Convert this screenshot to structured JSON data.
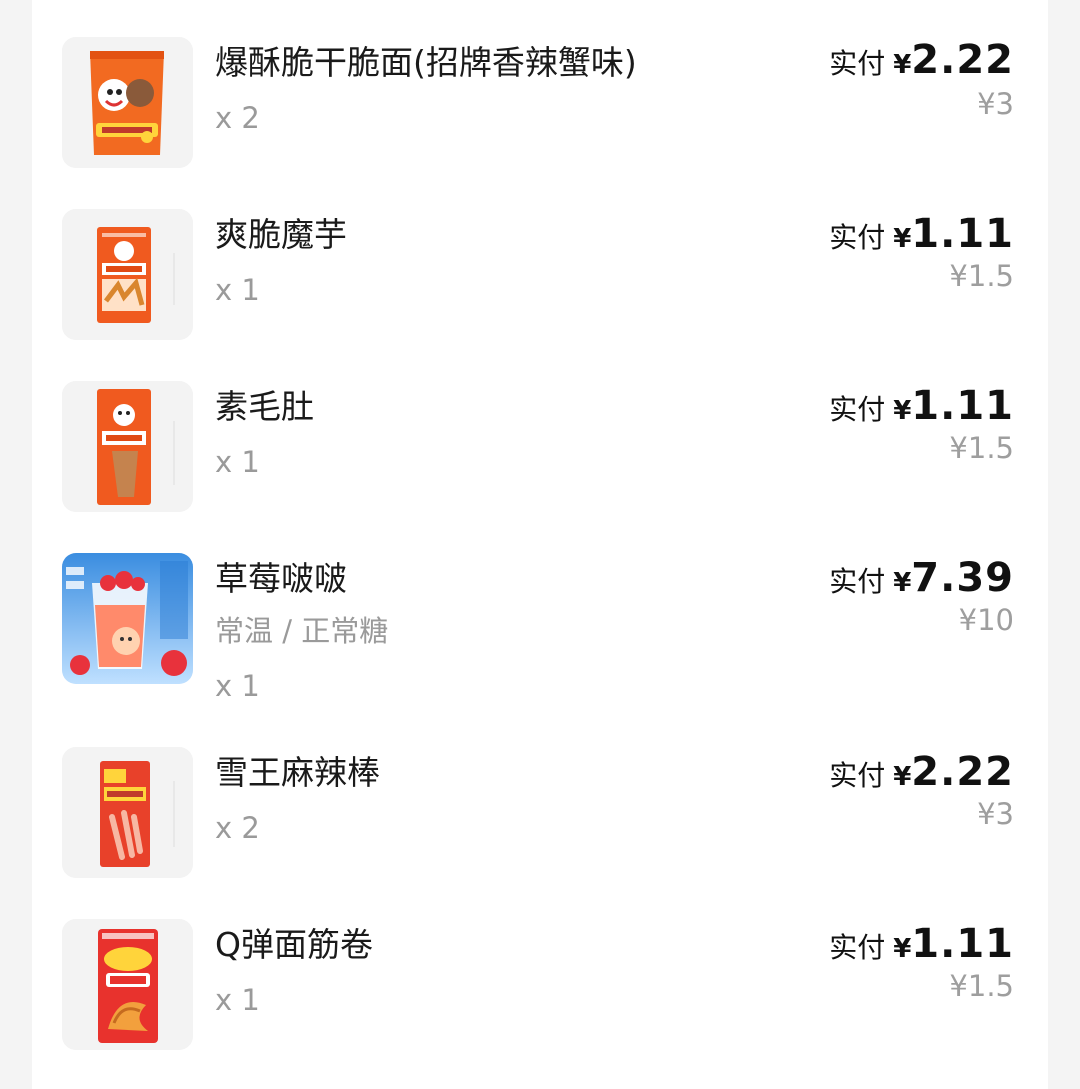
{
  "order": {
    "paid_label": "实付",
    "currency": "¥",
    "items": [
      {
        "name": "爆酥脆干脆面(招牌香辣蟹味)",
        "spec": "",
        "qty": "x 2",
        "paid": "2.22",
        "original": "¥3",
        "image": "snack-bag-icon"
      },
      {
        "name": "爽脆魔芋",
        "spec": "",
        "qty": "x 1",
        "paid": "1.11",
        "original": "¥1.5",
        "image": "konjac-pack-icon"
      },
      {
        "name": "素毛肚",
        "spec": "",
        "qty": "x 1",
        "paid": "1.11",
        "original": "¥1.5",
        "image": "tripe-pack-icon"
      },
      {
        "name": "草莓啵啵",
        "spec": "常温 / 正常糖",
        "qty": "x 1",
        "paid": "7.39",
        "original": "¥10",
        "image": "strawberry-drink-icon"
      },
      {
        "name": "雪王麻辣棒",
        "spec": "",
        "qty": "x 2",
        "paid": "2.22",
        "original": "¥3",
        "image": "spicy-stick-pack-icon"
      },
      {
        "name": "Q弹面筋卷",
        "spec": "",
        "qty": "x 1",
        "paid": "1.11",
        "original": "¥1.5",
        "image": "gluten-roll-pack-icon"
      }
    ]
  },
  "colors": {
    "card": "#ffffff",
    "background": "#f4f4f4",
    "text": "#1a1a1a",
    "muted": "#9a9a9a",
    "packaging": "#f05a1f"
  }
}
